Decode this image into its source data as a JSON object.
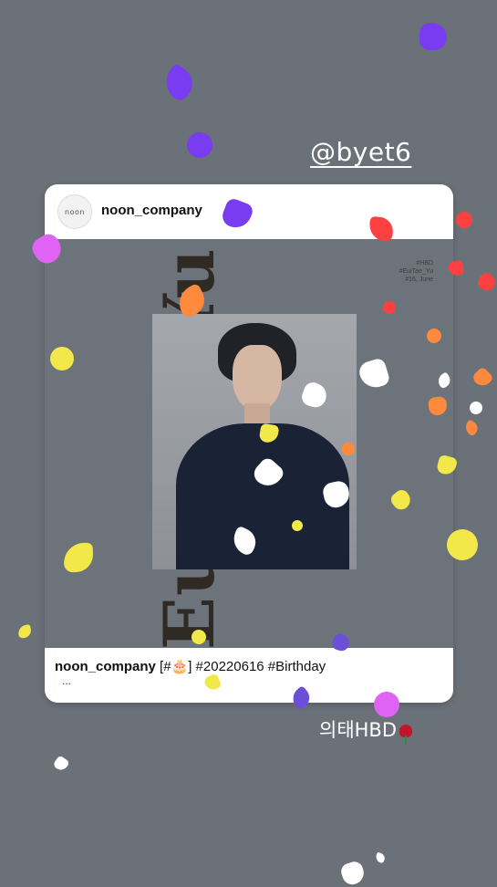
{
  "story": {
    "mention": "@byet6",
    "sticker_text": "의태HBD",
    "sticker_icon": "rose-icon"
  },
  "post": {
    "account": "noon_company",
    "avatar_text": "noon",
    "vertical_title": "Euitae. Yu",
    "tagline_lines": [
      "#HBD",
      "#EuiTae_Yu",
      "#16, June"
    ],
    "caption_account": "noon_company",
    "caption_text": " [#🎂] #20220616 #Birthday",
    "more": "..."
  },
  "colors": {
    "background": "#6b7178",
    "sparkles": [
      "#7a3cf0",
      "#ff4040",
      "#ff8a3d",
      "#f2e84a",
      "#ffffff",
      "#e063f5",
      "#6b4fd8"
    ]
  }
}
